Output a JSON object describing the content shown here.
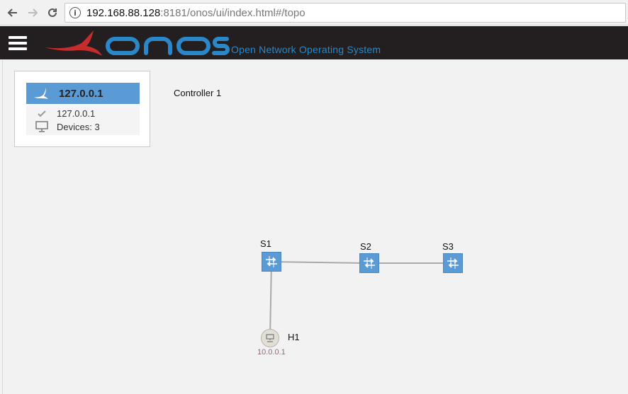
{
  "browser": {
    "url_host": "192.168.88.128",
    "url_rest": ":8181/onos/ui/index.html#/topo"
  },
  "header": {
    "logo_text": "onos",
    "tagline": "Open Network Operating System"
  },
  "instance_panel": {
    "title": "127.0.0.1",
    "ip": "127.0.0.1",
    "devices": "Devices: 3"
  },
  "controller_label": "Controller 1",
  "topology": {
    "switches": [
      {
        "id": "s1",
        "label": "S1"
      },
      {
        "id": "s2",
        "label": "S2"
      },
      {
        "id": "s3",
        "label": "S3"
      }
    ],
    "hosts": [
      {
        "id": "h1",
        "label": "H1",
        "ip": "10.0.0.1"
      }
    ]
  },
  "colors": {
    "header_bg": "#231f20",
    "accent_blue": "#5b9bd5",
    "logo_blue": "#2a87c8",
    "logo_red": "#c62c2c"
  }
}
